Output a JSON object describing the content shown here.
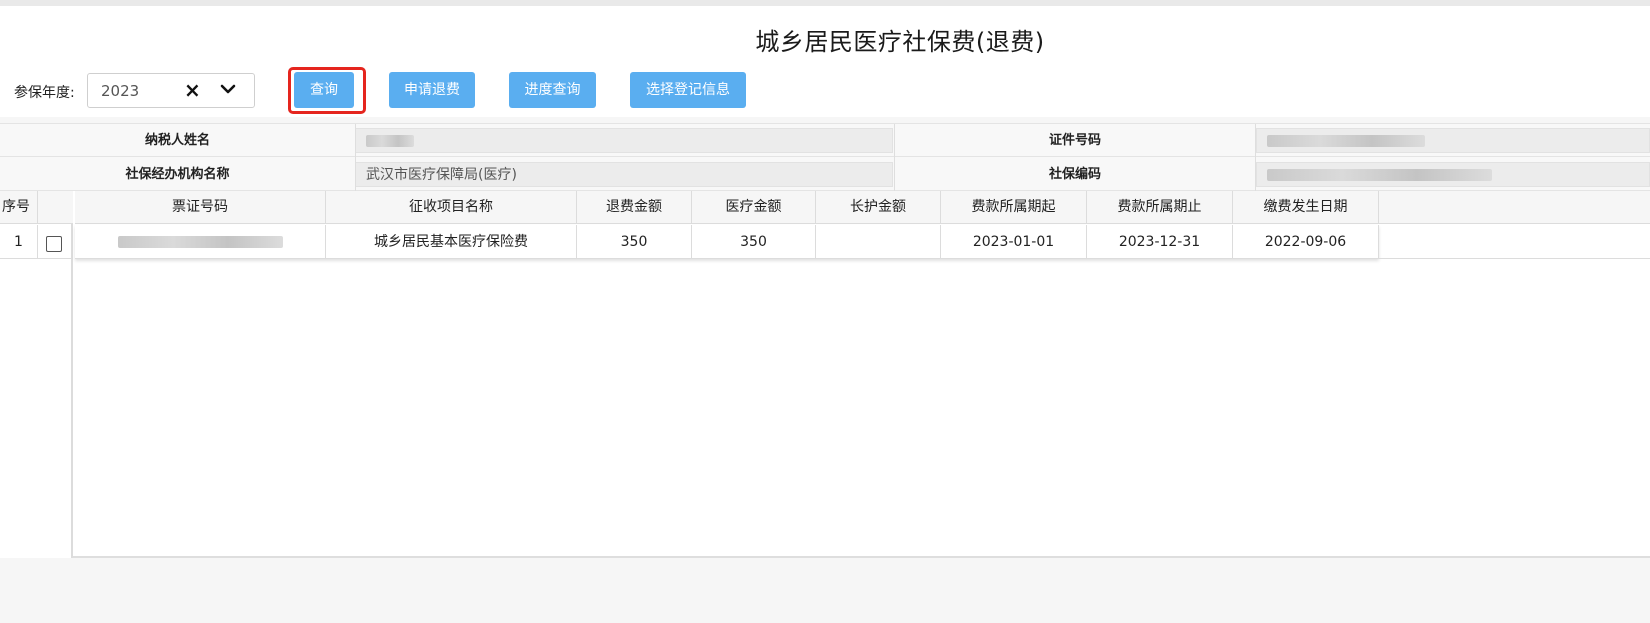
{
  "header": {
    "title": "城乡居民医疗社保费(退费)"
  },
  "filter": {
    "year_label": "参保年度:",
    "year_value": "2023"
  },
  "toolbar": {
    "query_label": "查询",
    "apply_refund_label": "申请退费",
    "progress_query_label": "进度查询",
    "select_registration_label": "选择登记信息"
  },
  "info": {
    "taxpayer_name_label": "纳税人姓名",
    "id_number_label": "证件号码",
    "agency_name_label": "社保经办机构名称",
    "agency_name_value": "武汉市医疗保障局(医疗)",
    "social_security_code_label": "社保编码"
  },
  "table": {
    "seq_header": "序号",
    "headers": [
      "票证号码",
      "征收项目名称",
      "退费金额",
      "医疗金额",
      "长护金额",
      "费款所属期起",
      "费款所属期止",
      "缴费发生日期"
    ],
    "rows": [
      {
        "seq": "1",
        "ticket_no": "",
        "item_name": "城乡居民基本医疗保险费",
        "refund_amount": "350",
        "medical_amount": "350",
        "long_term_care_amount": "",
        "period_start": "2023-01-01",
        "period_end": "2023-12-31",
        "payment_date": "2022-09-06"
      }
    ]
  },
  "colors": {
    "primary_button": "#5aaef0",
    "highlight_border": "#e5251e"
  }
}
